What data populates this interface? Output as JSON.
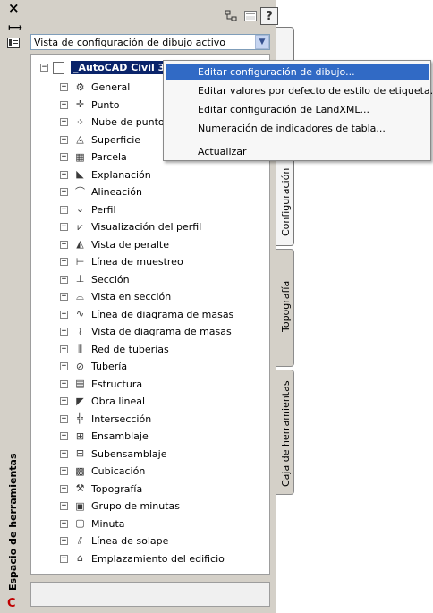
{
  "strip": {
    "title": "Espacio de herramientas",
    "close_icon": "close-icon",
    "pin_icon": "auto-hide-icon",
    "props_icon": "properties-icon",
    "logo_icon": "civil3d-logo-icon"
  },
  "toolbar": {
    "buttons": [
      {
        "name": "tree-view-icon"
      },
      {
        "name": "item-view-icon"
      },
      {
        "name": "help-icon",
        "label": "?"
      }
    ]
  },
  "view_selector": {
    "value": "Vista de configuración de dibujo activo"
  },
  "tree": {
    "root": {
      "expander": "−",
      "label": "_AutoCAD Civil 3D (Imperial) NCS"
    },
    "items": [
      {
        "label": "General",
        "icon": "general-icon"
      },
      {
        "label": "Punto",
        "icon": "point-icon"
      },
      {
        "label": "Nube de puntos",
        "icon": "point-cloud-icon"
      },
      {
        "label": "Superficie",
        "icon": "surface-icon"
      },
      {
        "label": "Parcela",
        "icon": "parcel-icon"
      },
      {
        "label": "Explanación",
        "icon": "grading-icon"
      },
      {
        "label": "Alineación",
        "icon": "alignment-icon"
      },
      {
        "label": "Perfil",
        "icon": "profile-icon"
      },
      {
        "label": "Visualización del perfil",
        "icon": "profile-view-icon"
      },
      {
        "label": "Vista de peralte",
        "icon": "superelevation-view-icon"
      },
      {
        "label": "Línea de muestreo",
        "icon": "sample-line-icon"
      },
      {
        "label": "Sección",
        "icon": "section-icon"
      },
      {
        "label": "Vista en sección",
        "icon": "section-view-icon"
      },
      {
        "label": "Línea de diagrama de masas",
        "icon": "mass-haul-line-icon"
      },
      {
        "label": "Vista de diagrama de masas",
        "icon": "mass-haul-view-icon"
      },
      {
        "label": "Red de tuberías",
        "icon": "pipe-network-icon"
      },
      {
        "label": "Tubería",
        "icon": "pipe-icon"
      },
      {
        "label": "Estructura",
        "icon": "structure-icon"
      },
      {
        "label": "Obra lineal",
        "icon": "corridor-icon"
      },
      {
        "label": "Intersección",
        "icon": "intersection-icon"
      },
      {
        "label": "Ensamblaje",
        "icon": "assembly-icon"
      },
      {
        "label": "Subensamblaje",
        "icon": "subassembly-icon"
      },
      {
        "label": "Cubicación",
        "icon": "quantity-takeoff-icon"
      },
      {
        "label": "Topografía",
        "icon": "survey-icon"
      },
      {
        "label": "Grupo de minutas",
        "icon": "view-frame-group-icon"
      },
      {
        "label": "Minuta",
        "icon": "view-frame-icon"
      },
      {
        "label": "Línea de solape",
        "icon": "match-line-icon"
      },
      {
        "label": "Emplazamiento del edificio",
        "icon": "building-site-icon"
      }
    ]
  },
  "tabs": [
    {
      "label": "Configuración",
      "active": true
    },
    {
      "label": "Topografía",
      "active": false
    },
    {
      "label": "Caja de herramientas",
      "active": false
    }
  ],
  "context_menu": {
    "items": [
      {
        "label": "Editar configuración de dibujo...",
        "highlighted": true
      },
      {
        "label": "Editar valores por defecto de estilo de etiqueta...",
        "highlighted": false
      },
      {
        "label": "Editar configuración de LandXML...",
        "highlighted": false
      },
      {
        "label": "Numeración de indicadores de tabla...",
        "highlighted": false
      },
      {
        "separator": true
      },
      {
        "label": "Actualizar",
        "highlighted": false
      }
    ]
  },
  "colors": {
    "selection": "#0a246a",
    "menu_highlight": "#316ac5",
    "panel_bg": "#d4d0c8"
  }
}
